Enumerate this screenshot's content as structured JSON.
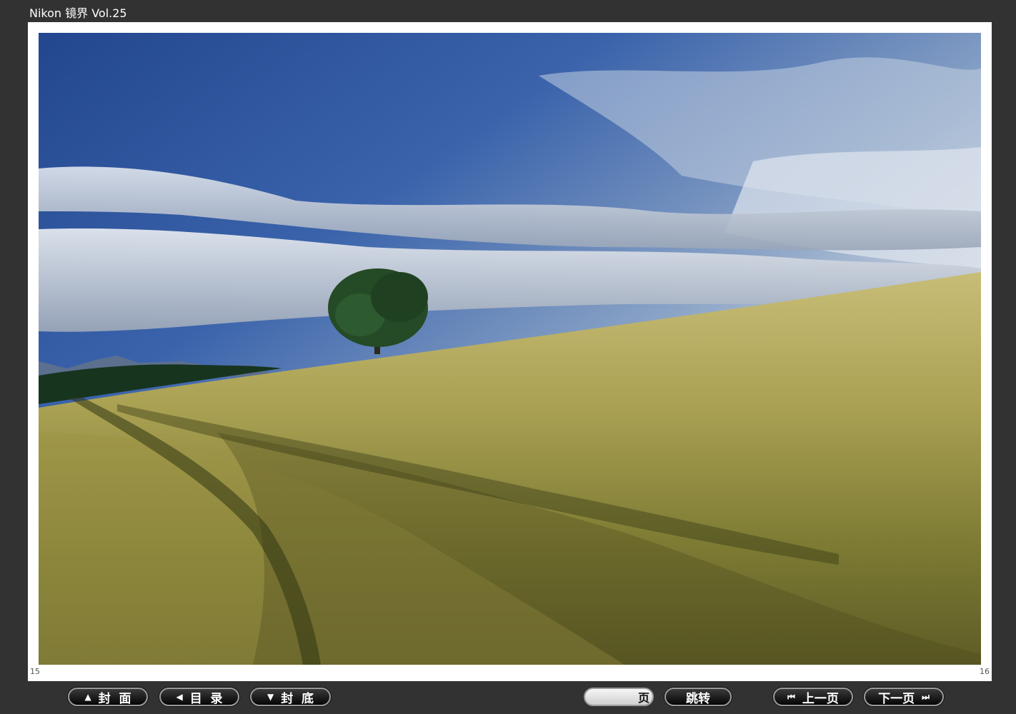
{
  "app": {
    "title": "Nikon 镜界 Vol.25"
  },
  "pages": {
    "left_number": "15",
    "right_number": "16"
  },
  "toolbar": {
    "cover": {
      "icon": "▲",
      "label": "封  面"
    },
    "toc": {
      "icon": "◀",
      "label": "目  录"
    },
    "back_cover": {
      "icon": "▼",
      "label": "封  底"
    },
    "page_input": {
      "value": "",
      "suffix": "页"
    },
    "jump": {
      "label": "跳转"
    },
    "prev": {
      "icon": "⏮",
      "label": "上一页"
    },
    "next": {
      "icon": "⏭",
      "label": "下一页"
    }
  },
  "colors": {
    "background": "#323232",
    "page": "#ffffff",
    "button": "#0c0c0c"
  }
}
